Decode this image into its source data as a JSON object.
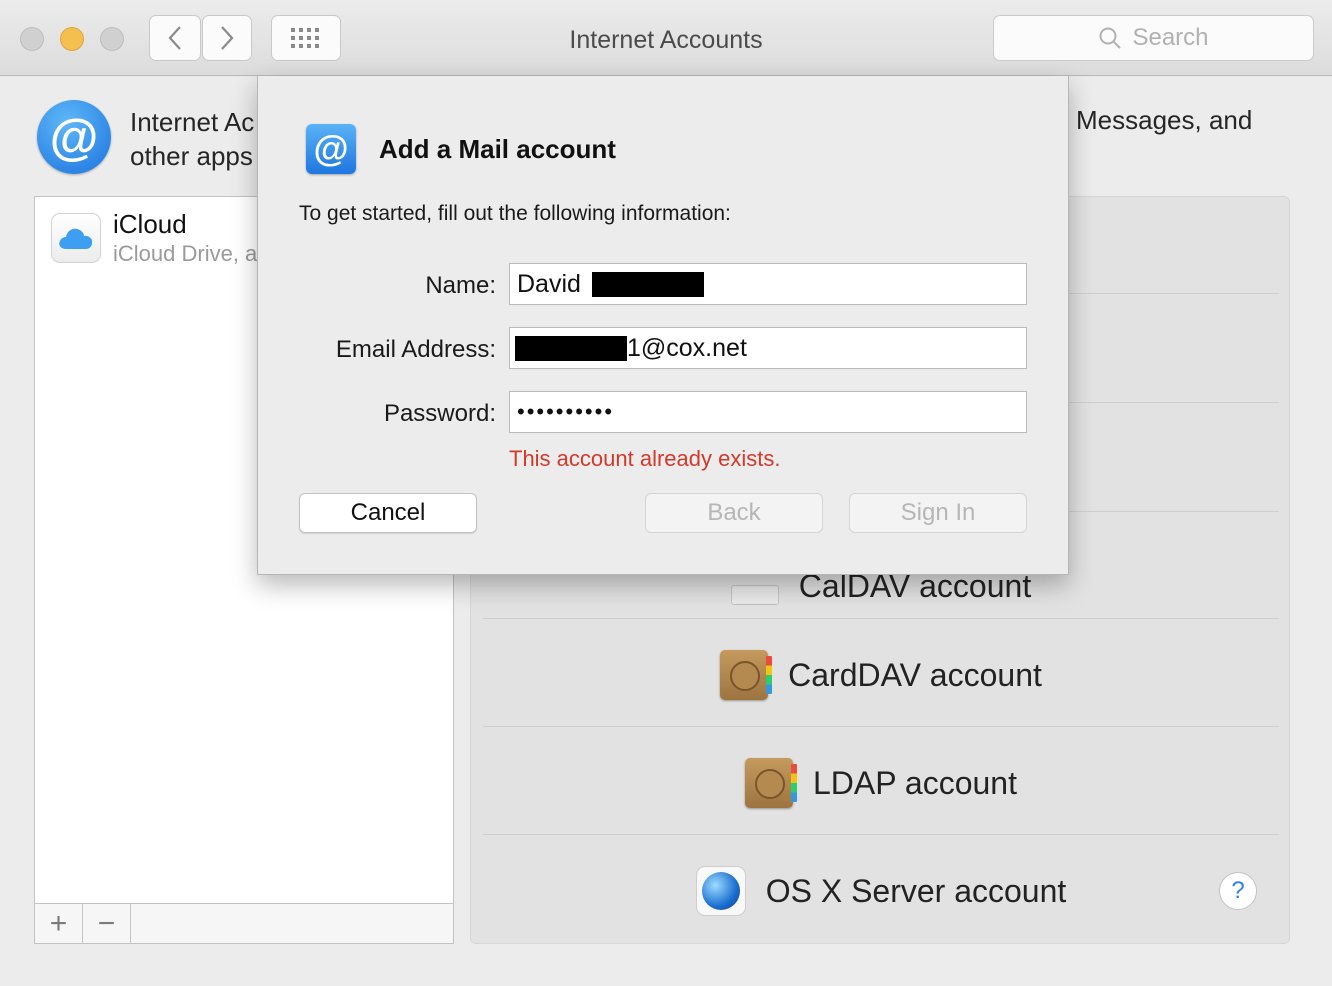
{
  "window": {
    "title": "Internet Accounts",
    "search_placeholder": "Search"
  },
  "header": {
    "text_line1": "Internet Ac",
    "text_line2": "other apps",
    "text_right": "Messages, and"
  },
  "accounts": [
    {
      "name": "iCloud",
      "description": "iCloud Drive, a"
    }
  ],
  "list_footer": {
    "add_label": "+",
    "remove_label": "−"
  },
  "providers": [
    {
      "label": "CalDAV account",
      "icon": "calendar-icon"
    },
    {
      "label": "CardDAV account",
      "icon": "contacts-book-icon"
    },
    {
      "label": "LDAP account",
      "icon": "contacts-book-icon"
    },
    {
      "label": "OS X Server account",
      "icon": "server-globe-icon"
    }
  ],
  "help_label": "?",
  "sheet": {
    "title": "Add a Mail account",
    "intro": "To get started, fill out the following information:",
    "fields": {
      "name_label": "Name:",
      "name_value": "David",
      "email_label": "Email Address:",
      "email_value": "1@cox.net",
      "password_label": "Password:",
      "password_value": "••••••••••"
    },
    "error": "This account already exists.",
    "buttons": {
      "cancel": "Cancel",
      "back": "Back",
      "sign_in": "Sign In"
    }
  }
}
